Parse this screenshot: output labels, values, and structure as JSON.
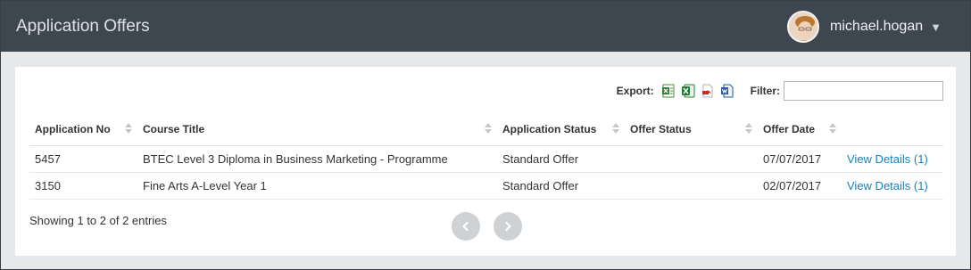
{
  "header": {
    "title": "Application Offers",
    "username": "michael.hogan",
    "caret": "▼"
  },
  "toolbar": {
    "export_label": "Export:",
    "export_icons": [
      "excel-csv-icon",
      "excel-icon",
      "pdf-icon",
      "word-icon"
    ],
    "filter_label": "Filter:",
    "filter_value": ""
  },
  "table": {
    "columns": [
      "Application No",
      "Course Title",
      "Application Status",
      "Offer Status",
      "Offer Date",
      ""
    ],
    "rows": [
      {
        "app_no": "5457",
        "course": "BTEC Level 3 Diploma in Business Marketing - Programme",
        "app_status": "Standard Offer",
        "offer_status": "",
        "offer_date": "07/07/2017",
        "action": "View Details (1)"
      },
      {
        "app_no": "3150",
        "course": "Fine Arts A-Level Year 1",
        "app_status": "Standard Offer",
        "offer_status": "",
        "offer_date": "02/07/2017",
        "action": "View Details (1)"
      }
    ]
  },
  "footer": {
    "info": "Showing 1 to 2 of 2 entries"
  },
  "colors": {
    "header_bg": "#3e4650",
    "page_bg": "#e6e8ea",
    "link": "#1a7fb4"
  }
}
